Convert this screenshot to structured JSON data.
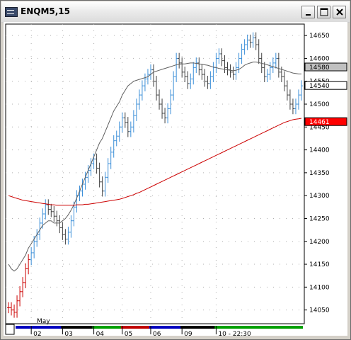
{
  "window": {
    "title": "ENQM5,15"
  },
  "price_tags": [
    {
      "label": "14580",
      "value": 14580.5,
      "color": "#c0c0c0",
      "text_color": "#000000"
    },
    {
      "label": "14540",
      "value": 14540,
      "color": "#ffffff",
      "text_color": "#000000"
    },
    {
      "label": "14461",
      "value": 14461,
      "color": "#ff0000",
      "text_color": "#ffffff"
    }
  ],
  "chart_data": {
    "type": "bar",
    "instrument": "ENQM5",
    "interval": "15",
    "y_ticks": [
      14050,
      14100,
      14150,
      14200,
      14250,
      14300,
      14350,
      14400,
      14450,
      14500,
      14550,
      14600,
      14650
    ],
    "ylim": [
      14020,
      14675
    ],
    "month_label": "May",
    "x_ticks": [
      "02",
      "03",
      "04",
      "05",
      "06",
      "09",
      "10 - 22:30"
    ],
    "x_tick_index": [
      8,
      19,
      30,
      40,
      50,
      61,
      73
    ],
    "session_colors": [
      "#0000c0",
      "#000000",
      "#00a000",
      "#c00000",
      "#0000c0",
      "#000000",
      "#00a000"
    ],
    "series": [
      {
        "name": "price",
        "values": [
          14055,
          14050,
          14045,
          14070,
          14090,
          14110,
          14140,
          14160,
          14175,
          14200,
          14215,
          14240,
          14260,
          14280,
          14270,
          14265,
          14255,
          14245,
          14230,
          14215,
          14205,
          14220,
          14245,
          14275,
          14300,
          14310,
          14325,
          14340,
          14355,
          14370,
          14380,
          14360,
          14330,
          14310,
          14340,
          14370,
          14395,
          14420,
          14430,
          14450,
          14470,
          14460,
          14440,
          14450,
          14475,
          14500,
          14520,
          14540,
          14555,
          14565,
          14575,
          14550,
          14520,
          14500,
          14480,
          14470,
          14490,
          14520,
          14560,
          14600,
          14590,
          14570,
          14560,
          14545,
          14555,
          14580,
          14590,
          14575,
          14565,
          14550,
          14545,
          14560,
          14580,
          14600,
          14610,
          14595,
          14580,
          14575,
          14570,
          14565,
          14580,
          14600,
          14620,
          14630,
          14640,
          14635,
          14645,
          14630,
          14600,
          14580,
          14560,
          14565,
          14580,
          14590,
          14600,
          14570,
          14560,
          14540,
          14520,
          14500,
          14490,
          14500,
          14520,
          14540
        ]
      },
      {
        "name": "sma-fast",
        "values": [
          14150,
          14140,
          14135,
          14140,
          14150,
          14160,
          14170,
          14185,
          14195,
          14205,
          14215,
          14225,
          14235,
          14240,
          14245,
          14245,
          14240,
          14240,
          14240,
          14245,
          14250,
          14258,
          14268,
          14280,
          14295,
          14310,
          14325,
          14340,
          14355,
          14370,
          14385,
          14400,
          14415,
          14425,
          14440,
          14455,
          14470,
          14485,
          14495,
          14505,
          14520,
          14530,
          14540,
          14545,
          14550,
          14552,
          14554,
          14556,
          14558,
          14560,
          14565,
          14570,
          14572,
          14574,
          14576,
          14578,
          14580,
          14582,
          14584,
          14586,
          14587,
          14588,
          14588,
          14589,
          14590,
          14590,
          14589,
          14588,
          14587,
          14586,
          14585,
          14583,
          14581,
          14580,
          14578,
          14577,
          14576,
          14575,
          14574,
          14573,
          14574,
          14576,
          14580,
          14585,
          14588,
          14590,
          14592,
          14592,
          14591,
          14589,
          14588,
          14586,
          14584,
          14582,
          14580,
          14578,
          14576,
          14574,
          14572,
          14570,
          14568,
          14567,
          14566,
          14566
        ]
      },
      {
        "name": "sma-slow",
        "values": [
          14300,
          14298,
          14296,
          14294,
          14292,
          14290,
          14289,
          14288,
          14287,
          14286,
          14285,
          14284,
          14283,
          14282,
          14281,
          14280,
          14280,
          14279,
          14279,
          14279,
          14279,
          14279,
          14279,
          14279,
          14280,
          14280,
          14280,
          14281,
          14281,
          14282,
          14283,
          14284,
          14285,
          14286,
          14287,
          14288,
          14289,
          14290,
          14291,
          14292,
          14294,
          14296,
          14298,
          14300,
          14302,
          14305,
          14307,
          14310,
          14313,
          14316,
          14319,
          14322,
          14325,
          14328,
          14331,
          14334,
          14337,
          14340,
          14343,
          14346,
          14349,
          14352,
          14355,
          14358,
          14361,
          14364,
          14367,
          14370,
          14373,
          14376,
          14379,
          14382,
          14385,
          14388,
          14391,
          14394,
          14397,
          14400,
          14403,
          14406,
          14409,
          14412,
          14415,
          14418,
          14421,
          14424,
          14427,
          14430,
          14433,
          14436,
          14439,
          14442,
          14445,
          14448,
          14451,
          14454,
          14457,
          14460,
          14462,
          14464,
          14466,
          14467,
          14468,
          14469
        ]
      }
    ],
    "up_color": "#3c8fd8",
    "down_color": "#404040",
    "early_color": "#cc0000",
    "sma_fast_color": "#606060",
    "sma_slow_color": "#cc0000",
    "grid": "dotted"
  }
}
